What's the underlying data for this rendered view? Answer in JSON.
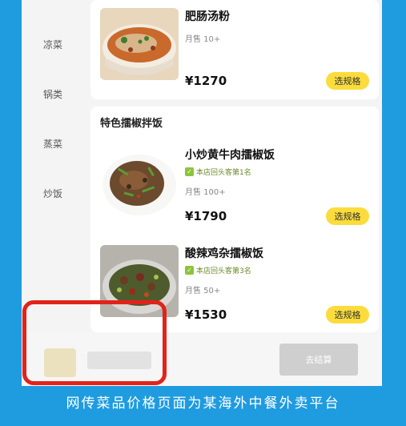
{
  "sidebar": {
    "items": [
      {
        "label": "凉菜"
      },
      {
        "label": "锅类"
      },
      {
        "label": "蒸菜"
      },
      {
        "label": "炒饭"
      }
    ]
  },
  "dishes_top": [
    {
      "name": "肥肠汤粉",
      "sales": "月售 10+",
      "price": "¥1270",
      "button": "选规格"
    }
  ],
  "section": {
    "title": "特色擂椒拌饭",
    "dishes": [
      {
        "name": "小炒黄牛肉擂椒饭",
        "rank": "本店回头客第1名",
        "sales": "月售 100+",
        "price": "¥1790",
        "button": "选规格"
      },
      {
        "name": "酸辣鸡杂擂椒饭",
        "rank": "本店回头客第3名",
        "sales": "月售 50+",
        "price": "¥1530",
        "button": "选规格"
      }
    ]
  },
  "checkout": {
    "label": "去结算"
  },
  "caption": "网传菜品价格页面为某海外中餐外卖平台",
  "colors": {
    "background": "#1f9be0",
    "button": "#fbdc3c",
    "highlight_box": "#e2231a"
  }
}
